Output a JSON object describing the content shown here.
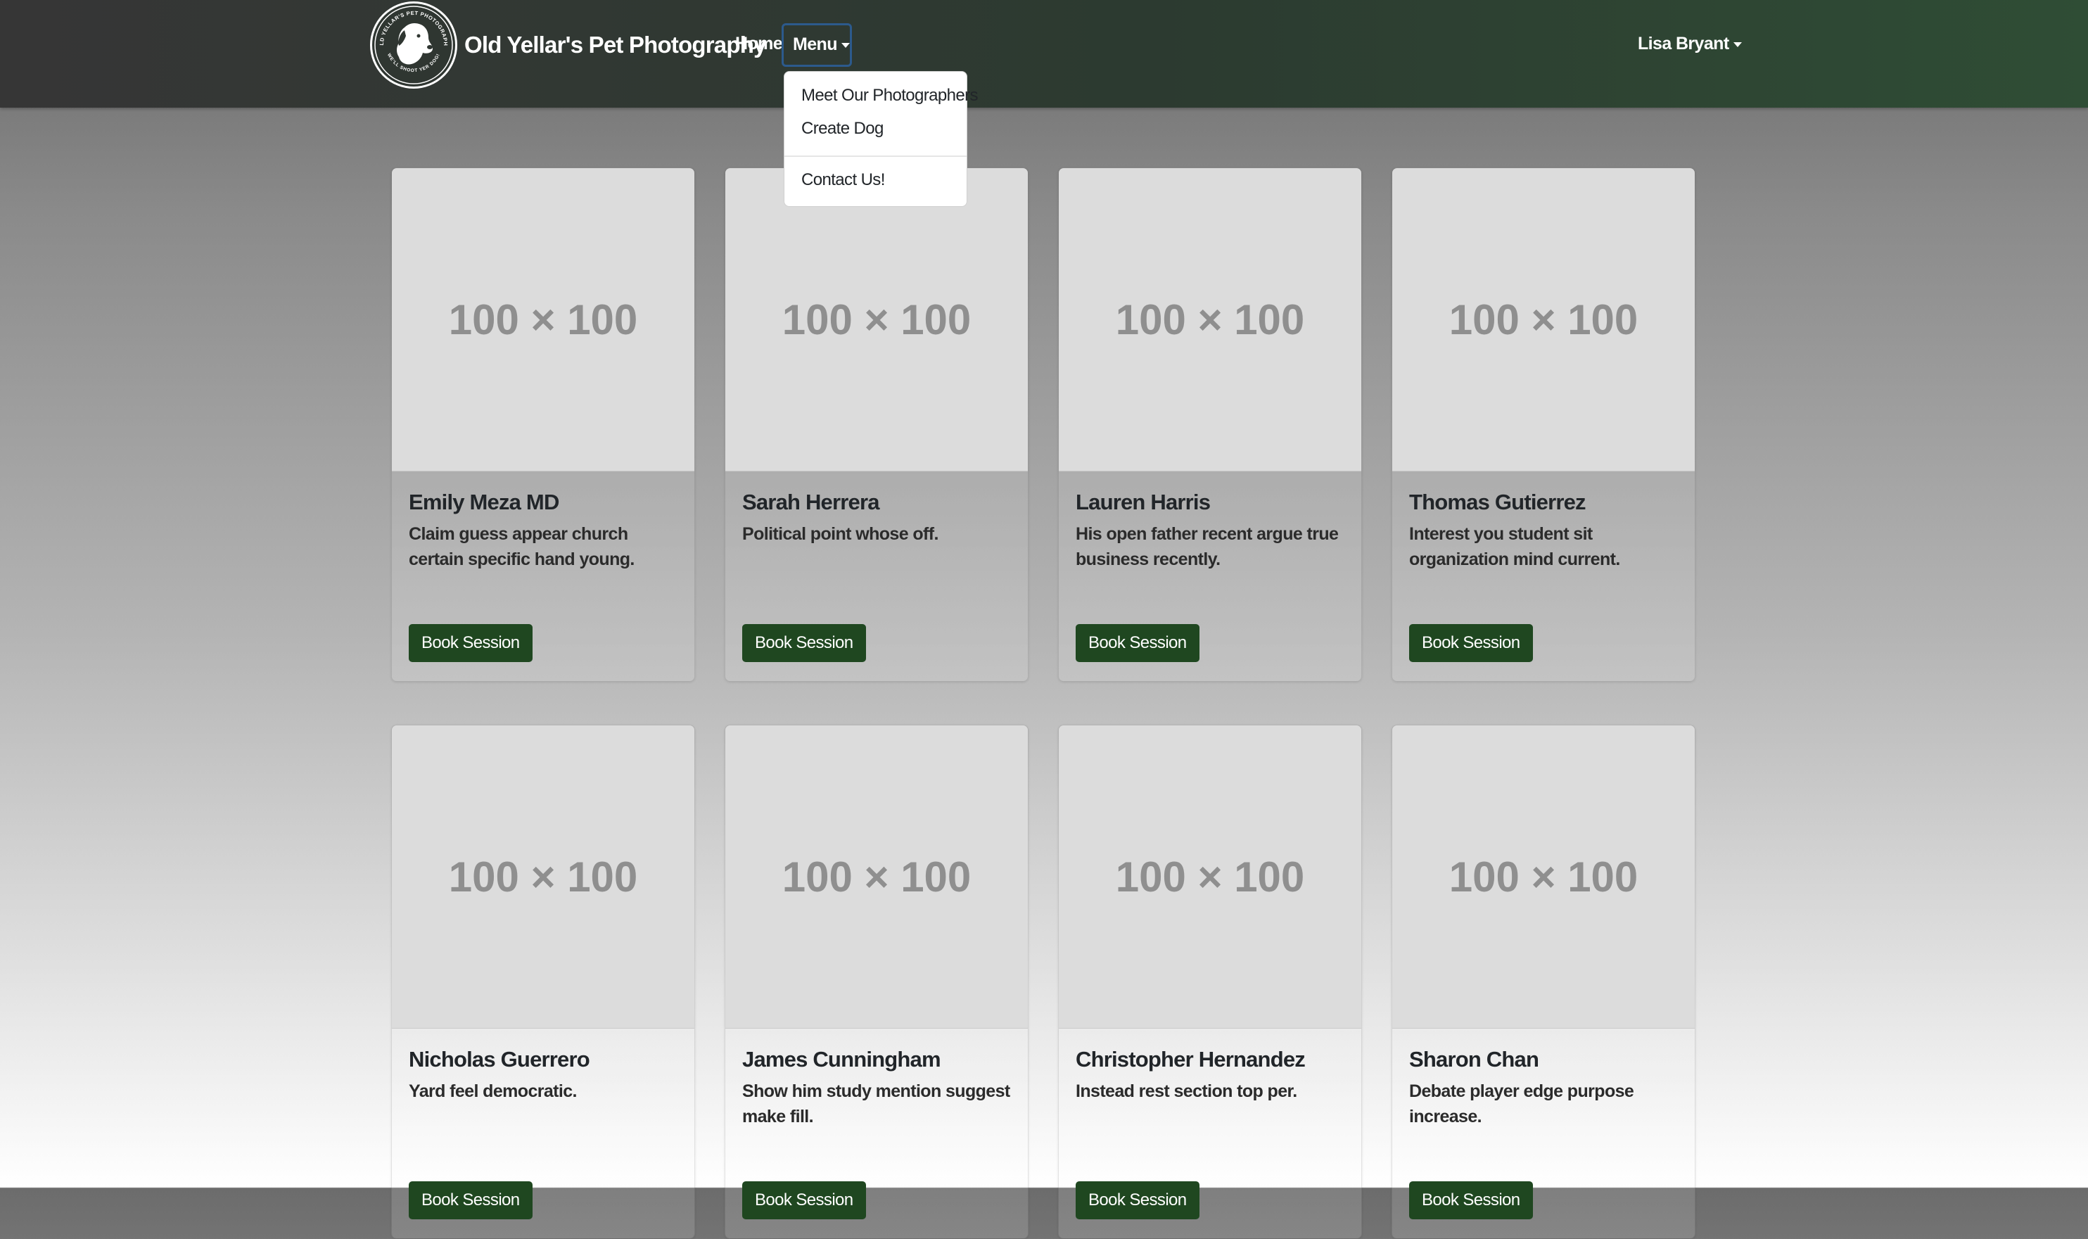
{
  "navbar": {
    "brand": "Old Yellar's Pet Photography",
    "logo_text_top": "OLD YELLAR'S PET PHOTOGRAPHY",
    "logo_text_bottom": "WE'LL SHOOT YER DOG!",
    "home": "Home",
    "menu": "Menu",
    "user": "Lisa Bryant"
  },
  "dropdown": {
    "items": [
      "Meet Our Photographers",
      "Create Dog",
      "Contact Us!"
    ]
  },
  "cards": [
    {
      "image_text": "100 × 100",
      "title": "Emily Meza MD",
      "text": "Claim guess appear church certain specific hand young.",
      "button": "Book Session"
    },
    {
      "image_text": "100 × 100",
      "title": "Sarah Herrera",
      "text": "Political point whose off.",
      "button": "Book Session"
    },
    {
      "image_text": "100 × 100",
      "title": "Lauren Harris",
      "text": "His open father recent argue true business recently.",
      "button": "Book Session"
    },
    {
      "image_text": "100 × 100",
      "title": "Thomas Gutierrez",
      "text": "Interest you student sit organization mind current.",
      "button": "Book Session"
    },
    {
      "image_text": "100 × 100",
      "title": "Nicholas Guerrero",
      "text": "Yard feel democratic.",
      "button": "Book Session"
    },
    {
      "image_text": "100 × 100",
      "title": "James Cunningham",
      "text": "Show him study mention suggest make fill.",
      "button": "Book Session"
    },
    {
      "image_text": "100 × 100",
      "title": "Christopher Hernandez",
      "text": "Instead rest section top per.",
      "button": "Book Session"
    },
    {
      "image_text": "100 × 100",
      "title": "Sharon Chan",
      "text": "Debate player edge purpose increase.",
      "button": "Book Session"
    }
  ]
}
